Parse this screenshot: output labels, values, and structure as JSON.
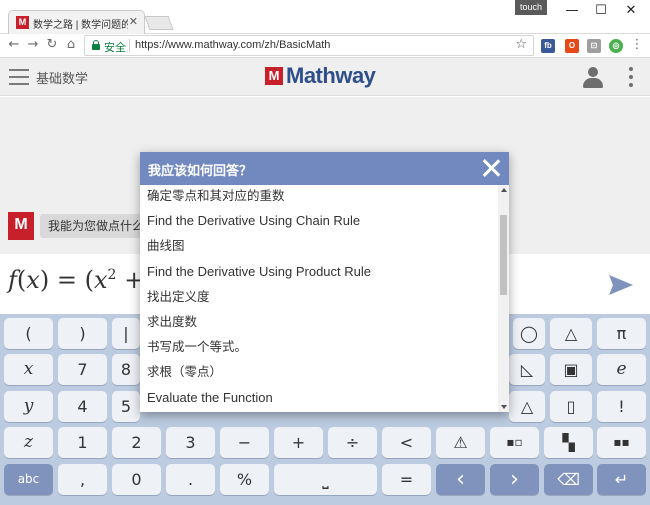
{
  "browser": {
    "tab_title": "数学之路 | 数学问题的解",
    "tab_favicon_text": "M",
    "touch_label": "touch",
    "window_controls": {
      "minimize": "—",
      "maximize": "☐",
      "close": "✕"
    },
    "nav": {
      "back": "←",
      "forward": "→",
      "reload": "↻",
      "home": "⌂"
    },
    "secure_label": "安全",
    "url": "https://www.mathway.com/zh/BasicMath",
    "extensions": [
      "fb",
      "office",
      "sync",
      "chrome"
    ]
  },
  "app": {
    "subject": "基础数学",
    "logo_mark": "M",
    "logo_text": "Mathway",
    "bot_avatar_text": "M",
    "bot_message": "我能为您做点什么",
    "expression": {
      "f": "f",
      "lp": "(",
      "x": "x",
      "rp": ")",
      "eq": "=",
      "lp2": "(",
      "x2": "x",
      "exp": "2",
      "plus": "+"
    }
  },
  "modal": {
    "title": "我应该如何回答？",
    "options": [
      "确定零点和其对应的重数",
      "Find the Derivative Using Chain Rule",
      "曲线图",
      "Find the Derivative Using Product Rule",
      "找出定义度",
      "求出度数",
      "书写成一个等式。",
      "求根（零点）",
      "Evaluate the Function"
    ]
  },
  "keypad": {
    "row1": [
      "(",
      ")",
      "|",
      "",
      "",
      "",
      "",
      "",
      "",
      "",
      "",
      "π"
    ],
    "row2": [
      "x",
      "7",
      "8",
      "",
      "",
      "",
      "",
      "",
      "",
      "",
      "",
      "e"
    ],
    "row3": [
      "y",
      "4",
      "5",
      "",
      "",
      "",
      "",
      "",
      "",
      "",
      "",
      "!"
    ],
    "row4": [
      "z",
      "1",
      "2",
      "3",
      "−",
      "+",
      "÷",
      "<",
      "",
      "",
      "",
      ""
    ],
    "row5": [
      "abc",
      ",",
      "0",
      ".",
      "%",
      "⎵",
      "=",
      "‹",
      "›",
      "⌫",
      "↵"
    ]
  },
  "colors": {
    "brand_red": "#c8202b",
    "brand_blue": "#2f4f8a",
    "modal_header": "#7289c0",
    "keypad_bg": "#bccbe0",
    "key_dark": "#7f93bd"
  }
}
